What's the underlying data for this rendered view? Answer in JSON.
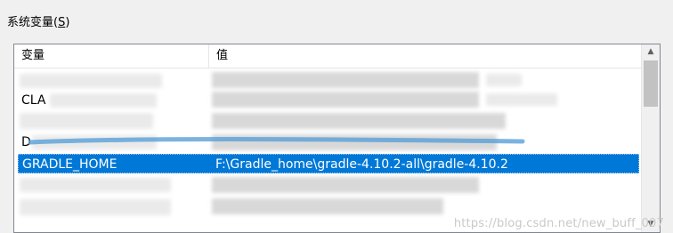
{
  "group": {
    "label_prefix": "系统变量(",
    "label_accel": "S",
    "label_suffix": ")"
  },
  "table": {
    "columns": {
      "name": "变量",
      "value": "值"
    },
    "rows": [
      {
        "name": "",
        "value": "",
        "selected": false
      },
      {
        "name": "CLA",
        "value": "",
        "selected": false
      },
      {
        "name": "",
        "value": "",
        "selected": false
      },
      {
        "name": "D",
        "value": "",
        "selected": false
      },
      {
        "name": "GRADLE_HOME",
        "value": "F:\\Gradle_home\\gradle-4.10.2-all\\gradle-4.10.2",
        "selected": true
      },
      {
        "name": "",
        "value": "",
        "selected": false
      },
      {
        "name": "",
        "value": "",
        "selected": false
      }
    ]
  },
  "scrollbar": {
    "up_icon": "chevron-up-icon",
    "down_icon": "chevron-down-icon"
  },
  "colors": {
    "selection": "#0078d7",
    "selection_text": "#ffffff",
    "annotation_stroke": "#5aa0d8"
  },
  "watermark": {
    "text": "https://blog.csdn.net/new_buff_007"
  }
}
